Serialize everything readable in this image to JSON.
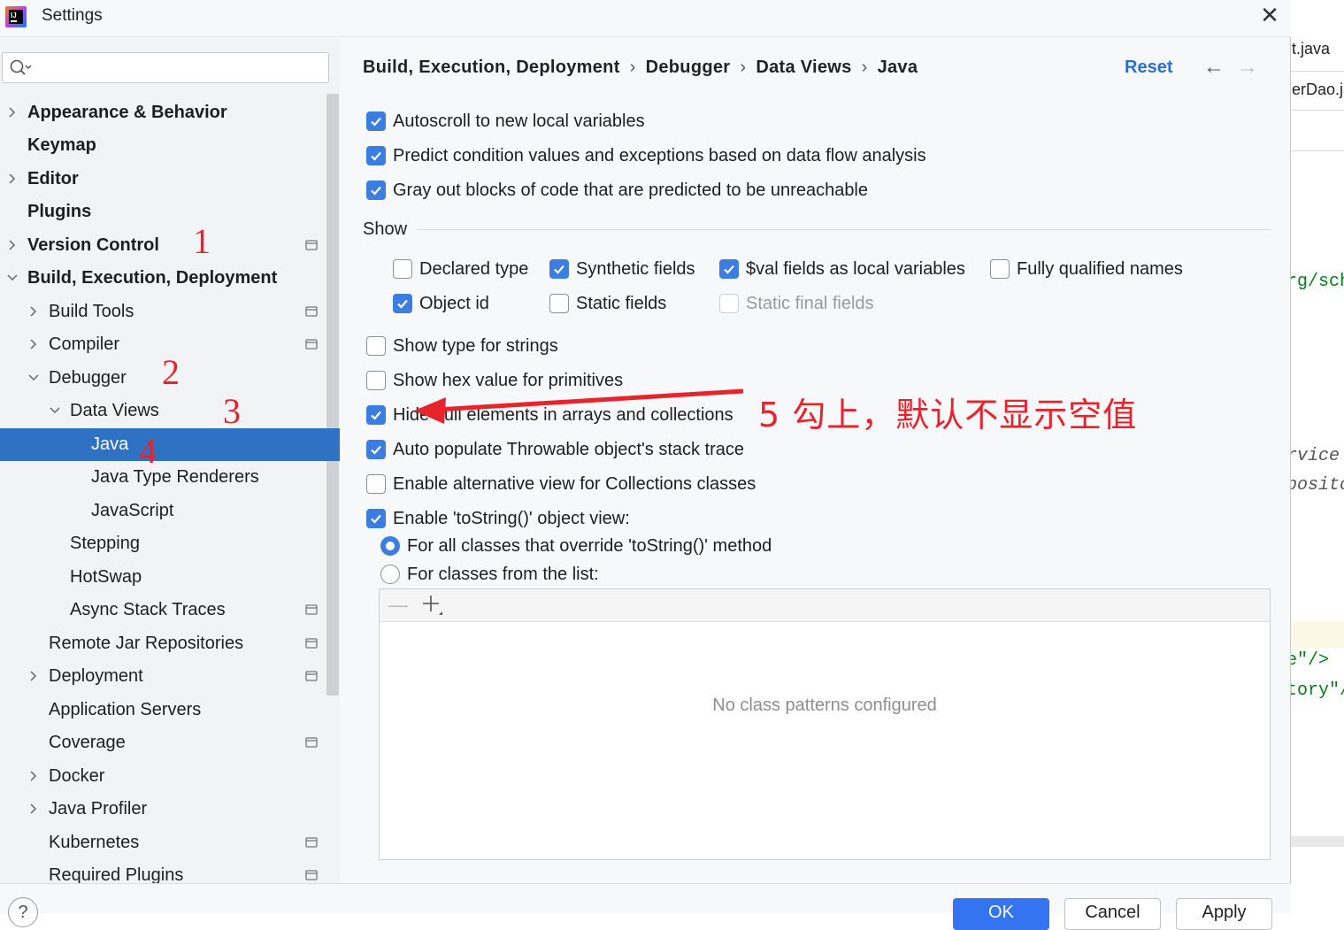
{
  "window": {
    "title": "Settings",
    "close_label": "✕"
  },
  "background_editor": {
    "tabs": [
      "t.java",
      "erDao.ja"
    ],
    "code_lines": [
      "rg/sch",
      "rvice'",
      "posito",
      "e\"/>",
      "tory\"/"
    ]
  },
  "sidebar": {
    "search_placeholder": "",
    "items": [
      {
        "label": "Appearance & Behavior"
      },
      {
        "label": "Keymap"
      },
      {
        "label": "Editor"
      },
      {
        "label": "Plugins"
      },
      {
        "label": "Version Control"
      },
      {
        "label": "Build, Execution, Deployment"
      },
      {
        "label": "Build Tools"
      },
      {
        "label": "Compiler"
      },
      {
        "label": "Debugger"
      },
      {
        "label": "Data Views"
      },
      {
        "label": "Java"
      },
      {
        "label": "Java Type Renderers"
      },
      {
        "label": "JavaScript"
      },
      {
        "label": "Stepping"
      },
      {
        "label": "HotSwap"
      },
      {
        "label": "Async Stack Traces"
      },
      {
        "label": "Remote Jar Repositories"
      },
      {
        "label": "Deployment"
      },
      {
        "label": "Application Servers"
      },
      {
        "label": "Coverage"
      },
      {
        "label": "Docker"
      },
      {
        "label": "Java Profiler"
      },
      {
        "label": "Kubernetes"
      },
      {
        "label": "Required Plugins"
      }
    ],
    "annotations": [
      "1",
      "2",
      "3",
      "4"
    ]
  },
  "content": {
    "breadcrumb": [
      "Build, Execution, Deployment",
      "Debugger",
      "Data Views",
      "Java"
    ],
    "breadcrumb_separator": "›",
    "reset_label": "Reset",
    "back_icon": "←",
    "forward_icon": "→",
    "top_options": [
      {
        "label": "Autoscroll to new local variables",
        "checked": true
      },
      {
        "label": "Predict condition values and exceptions based on data flow analysis",
        "checked": true
      },
      {
        "label": "Gray out blocks of code that are predicted to be unreachable",
        "checked": true
      }
    ],
    "show_group": {
      "title": "Show",
      "options": [
        {
          "label": "Declared type",
          "checked": false
        },
        {
          "label": "Synthetic fields",
          "checked": true
        },
        {
          "label": "$val fields as local variables",
          "checked": true
        },
        {
          "label": "Fully qualified names",
          "checked": false
        },
        {
          "label": "Object id",
          "checked": true
        },
        {
          "label": "Static fields",
          "checked": false
        },
        {
          "label": "Static final fields",
          "checked": false,
          "disabled": true
        }
      ]
    },
    "more_options": [
      {
        "label": "Show type for strings",
        "checked": false
      },
      {
        "label": "Show hex value for primitives",
        "checked": false
      },
      {
        "label": "Hide null elements in arrays and collections",
        "checked": true
      },
      {
        "label": "Auto populate Throwable object's stack trace",
        "checked": true
      },
      {
        "label": "Enable alternative view for Collections classes",
        "checked": false
      },
      {
        "label": "Enable 'toString()' object view:",
        "checked": true
      }
    ],
    "tostring_radios": [
      {
        "label": "For all classes that override 'toString()' method",
        "selected": true
      },
      {
        "label": "For classes from the list:",
        "selected": false
      }
    ],
    "list_empty_text": "No class patterns configured",
    "remove_icon": "—",
    "annotation_5": "5  勾上，默认不显示空值"
  },
  "footer": {
    "help_label": "?",
    "ok_label": "OK",
    "cancel_label": "Cancel",
    "apply_label": "Apply"
  },
  "colors": {
    "accent": "#3574f0",
    "selection": "#2f72c4",
    "annotation": "#e8232b",
    "link": "#2c6fd1"
  }
}
